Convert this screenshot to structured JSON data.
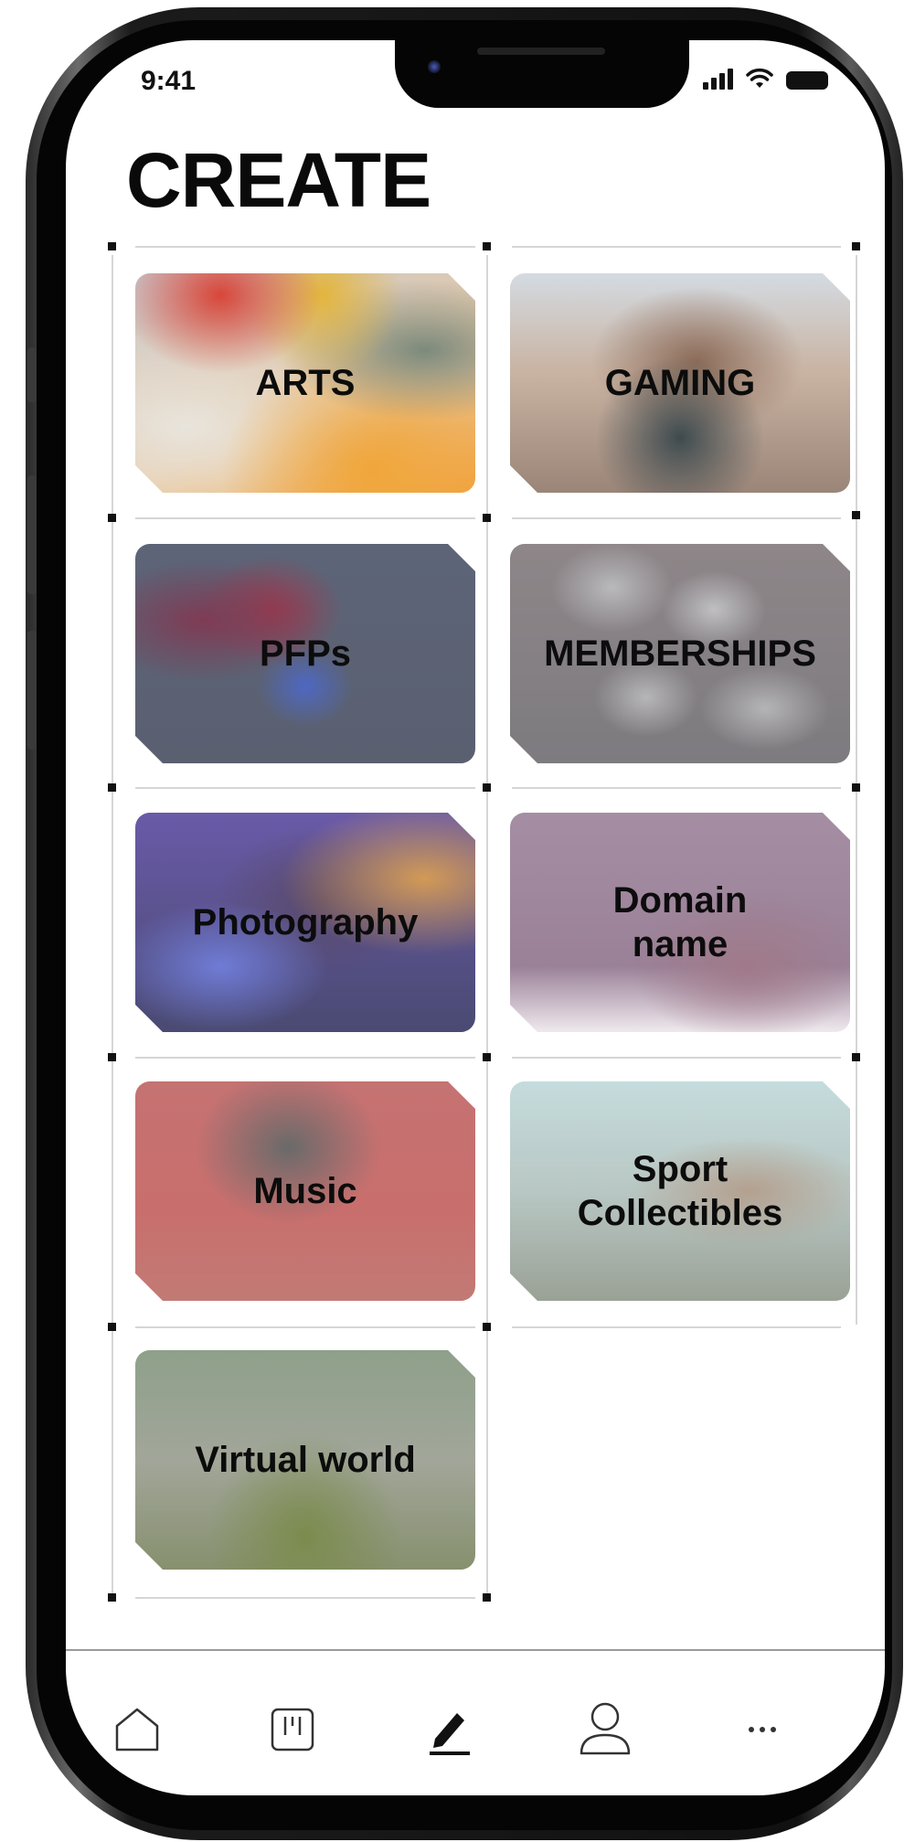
{
  "status_bar": {
    "time": "9:41",
    "signal_icon": "cellular-signal-icon",
    "wifi_icon": "wifi-icon",
    "battery_icon": "battery-icon"
  },
  "page": {
    "title": "CREATE"
  },
  "categories": [
    {
      "label": "ARTS",
      "image": "blurred-colorful-paint-image"
    },
    {
      "label": "GAMING",
      "image": "blurred-game-controller-image"
    },
    {
      "label": "PFPs",
      "image": "blurred-pixel-avatar-image"
    },
    {
      "label": "MEMBERSHIPS",
      "image": "blurred-grid-cards-image"
    },
    {
      "label": "Photography",
      "image": "blurred-camera-image"
    },
    {
      "label": "Domain\nname",
      "image": "blurred-domain-image"
    },
    {
      "label": "Music",
      "image": "blurred-musician-image"
    },
    {
      "label": "Sport\nCollectibles",
      "image": "blurred-stadium-image"
    },
    {
      "label": "Virtual world",
      "image": "blurred-forest-image"
    }
  ],
  "tab_bar": {
    "tabs": [
      {
        "icon": "home-icon",
        "active": false
      },
      {
        "icon": "stats-board-icon",
        "active": false
      },
      {
        "icon": "pencil-create-icon",
        "active": true
      },
      {
        "icon": "profile-icon",
        "active": false
      },
      {
        "icon": "more-icon",
        "active": false
      }
    ]
  }
}
